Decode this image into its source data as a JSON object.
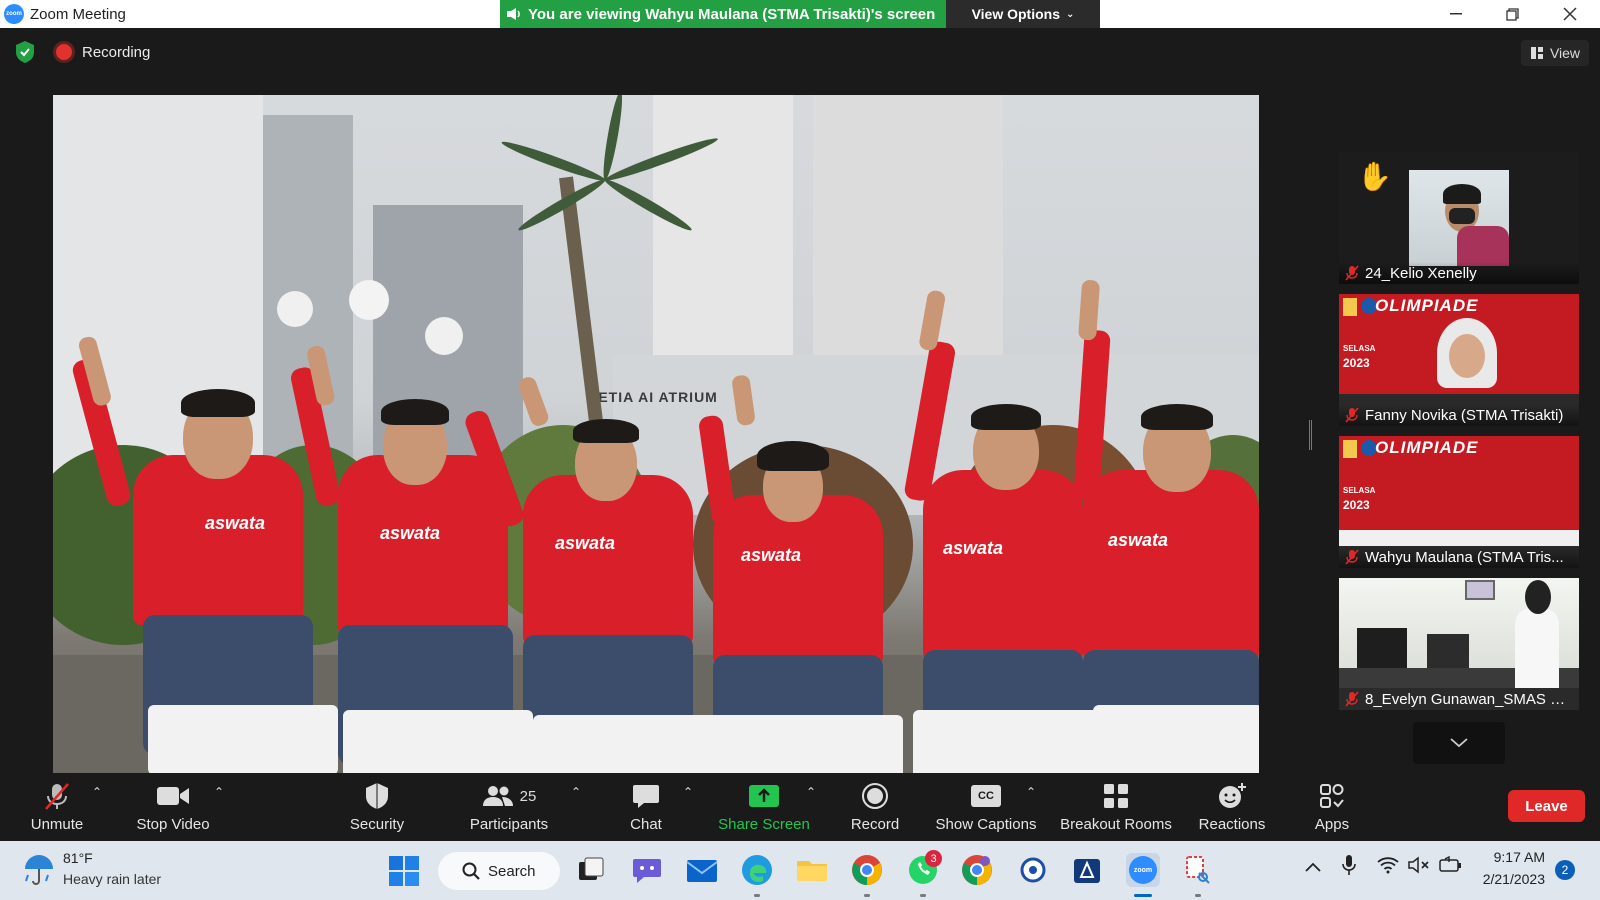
{
  "window": {
    "title": "Zoom Meeting",
    "logo_text": "zoom",
    "viewing_banner": "You are viewing Wahyu Maulana (STMA Trisakti)'s screen",
    "view_options_label": "View Options"
  },
  "status": {
    "recording_label": "Recording",
    "view_label": "View"
  },
  "shared_screen": {
    "sign_text": "SETIA   AI ATRIUM",
    "shirt_logo": "aswata"
  },
  "participants": [
    {
      "name": "24_Kelio Xenelly",
      "muted": true,
      "hand_raised": true
    },
    {
      "name": "Fanny Novika (STMA Trisakti)",
      "muted": true,
      "background": "OLIMPIADE"
    },
    {
      "name": "Wahyu Maulana (STMA Tris...",
      "muted": true,
      "background": "OLIMPIADE"
    },
    {
      "name": "8_Evelyn Gunawan_SMAS Kr...",
      "muted": true
    }
  ],
  "olimpiade": {
    "title": "OLIMPIADE",
    "day": "SELASA",
    "year": "2023"
  },
  "toolbar": {
    "unmute": "Unmute",
    "stop_video": "Stop Video",
    "security": "Security",
    "participants": "Participants",
    "participants_count": "25",
    "chat": "Chat",
    "share_screen": "Share Screen",
    "record": "Record",
    "show_captions": "Show Captions",
    "captions_icon_text": "CC",
    "breakout_rooms": "Breakout Rooms",
    "reactions": "Reactions",
    "apps": "Apps",
    "leave": "Leave"
  },
  "taskbar": {
    "weather_temp": "81°F",
    "weather_desc": "Heavy rain later",
    "search_label": "Search",
    "whatsapp_badge": "3",
    "time": "9:17 AM",
    "date": "2/21/2023",
    "notifications": "2",
    "zoom_icon_text": "zoom"
  },
  "colors": {
    "banner_green": "#23a043",
    "leave_red": "#e02828",
    "share_green": "#23c551",
    "shirt_red": "#d81f2a"
  }
}
